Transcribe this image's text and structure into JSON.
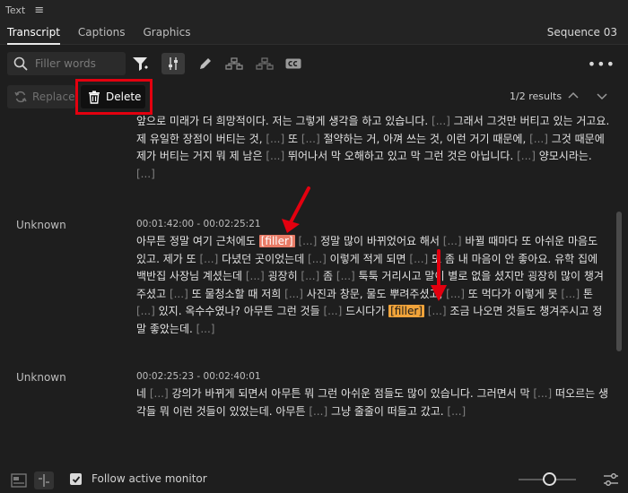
{
  "panel": {
    "title": "Text"
  },
  "tabs": [
    {
      "label": "Transcript"
    },
    {
      "label": "Captions"
    },
    {
      "label": "Graphics"
    }
  ],
  "sequence_name": "Sequence 03",
  "search": {
    "placeholder": "Filler words"
  },
  "actions": {
    "replace_label": "Replace",
    "delete_label": "Delete"
  },
  "results": {
    "label": "1/2 results"
  },
  "icons": {
    "search": "search-icon",
    "filter": "filter-icon",
    "settings_sliders": "sliders-icon",
    "pen": "pen-icon",
    "merge": "merge-segments-icon",
    "split": "split-segments-icon",
    "cc": "closed-captions-icon",
    "more": "more-horizontal-icon"
  },
  "colors": {
    "highlight_box": "#e3000f",
    "filler_active": "#e87b66",
    "filler_other": "#f0a33a"
  },
  "transcript": {
    "filler_tag": "filler",
    "gap_tag": "[...]",
    "blocks": [
      {
        "speaker": "",
        "timecode": "",
        "segments": [
          [
            "t",
            "앞으로 미래가 더 희망적이다. 저는 그렇게 생각을 하고 있습니다. "
          ],
          [
            "g",
            "[...]"
          ],
          [
            "t",
            " 그래서 그것만 버티고 있는 거고요. 제 유일한 장점이 버티는 것, "
          ],
          [
            "g",
            "[...]"
          ],
          [
            "t",
            " 또 "
          ],
          [
            "g",
            "[...]"
          ],
          [
            "t",
            " 절약하는 거, 아껴 쓰는 것, 이런 거기 때문에, "
          ],
          [
            "g",
            "[...]"
          ],
          [
            "t",
            " 그것 때문에 제가 버티는 거지 뭐 제 남은 "
          ],
          [
            "g",
            "[...]"
          ],
          [
            "t",
            " 뛰어나서 막 오해하고 있고 막 그런 것은 아닙니다. "
          ],
          [
            "g",
            "[...]"
          ],
          [
            "t",
            " 양모시라는. "
          ],
          [
            "g",
            "[...]"
          ]
        ]
      },
      {
        "speaker": "Unknown",
        "timecode": "00:01:42:00 - 00:02:25:21",
        "segments": [
          [
            "t",
            "아무튼 정말 여기 근처에도 "
          ],
          [
            "fa",
            "[filler]"
          ],
          [
            "t",
            " "
          ],
          [
            "g",
            "[...]"
          ],
          [
            "t",
            " 정말 많이 바뀌었어요 해서 "
          ],
          [
            "g",
            "[...]"
          ],
          [
            "t",
            " 바뀔 때마다 또 아쉬운 마음도 있고. 제가 또 "
          ],
          [
            "g",
            "[...]"
          ],
          [
            "t",
            " 다녔던 곳이었는데 "
          ],
          [
            "g",
            "[...]"
          ],
          [
            "t",
            " 이렇게 적게 되면 "
          ],
          [
            "g",
            "[...]"
          ],
          [
            "t",
            " 또 좀 내 마음이 안 좋아요. 유학 집에 백반집 사장님 계셨는데 "
          ],
          [
            "g",
            "[...]"
          ],
          [
            "t",
            " 굉장히 "
          ],
          [
            "g",
            "[...]"
          ],
          [
            "t",
            " 좀 "
          ],
          [
            "g",
            "[...]"
          ],
          [
            "t",
            " 툭툭 거리시고 말이 별로 없을 셨지만 굉장히 많이 챙겨주셨고 "
          ],
          [
            "g",
            "[...]"
          ],
          [
            "t",
            " 또 물청소할 때 저희 "
          ],
          [
            "g",
            "[...]"
          ],
          [
            "t",
            " 사진과 창문, 물도 뿌려주셨고, "
          ],
          [
            "g",
            "[...]"
          ],
          [
            "t",
            " 또 먹다가 이렇게 못 "
          ],
          [
            "g",
            "[...]"
          ],
          [
            "t",
            " 톤 "
          ],
          [
            "g",
            "[...]"
          ],
          [
            "t",
            " 있지. 옥수수였나? 아무튼 그런 것들 "
          ],
          [
            "g",
            "[...]"
          ],
          [
            "t",
            " 드시다가 "
          ],
          [
            "fb",
            "[filler]"
          ],
          [
            "t",
            " "
          ],
          [
            "g",
            "[...]"
          ],
          [
            "t",
            " 조금 나오면 것들도 챙겨주시고 정말 좋았는데. "
          ],
          [
            "g",
            "[...]"
          ]
        ]
      },
      {
        "speaker": "Unknown",
        "timecode": "00:02:25:23 - 00:02:40:01",
        "segments": [
          [
            "t",
            "네 "
          ],
          [
            "g",
            "[...]"
          ],
          [
            "t",
            " 강의가 바뀌게 되면서 아무튼 뭐 그런 아쉬운 점들도 많이 있습니다. 그러면서 막 "
          ],
          [
            "g",
            "[...]"
          ],
          [
            "t",
            " 떠오르는 생각들 뭐 이런 것들이 있었는데. 아무튼 "
          ],
          [
            "g",
            "[...]"
          ],
          [
            "t",
            " 그냥 줄줄이 떠들고 갔고. "
          ],
          [
            "g",
            "[...]"
          ]
        ]
      }
    ]
  },
  "footer": {
    "follow_label": "Follow active monitor",
    "follow_checked": true,
    "zoom_level": 0.55
  }
}
